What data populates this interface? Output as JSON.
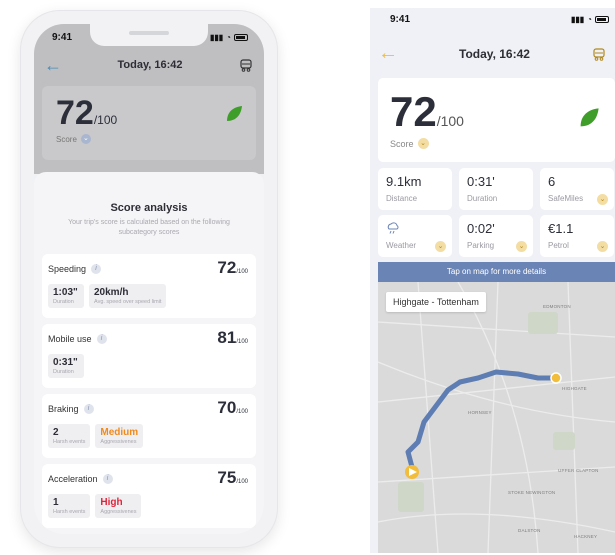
{
  "left_phone": {
    "status_time": "9:41",
    "nav_title": "Today, 16:42",
    "score": {
      "value": "72",
      "out_of": "/100",
      "label": "Score"
    },
    "sheet": {
      "title": "Score analysis",
      "subtitle": "Your trip's score is calculated based on the following subcategory scores"
    },
    "categories": [
      {
        "name": "Speeding",
        "score": "72",
        "out_of": "/100",
        "chips": [
          {
            "value": "1:03\"",
            "label": "Duration"
          },
          {
            "value": "20km/h",
            "label": "Avg. speed over speed limit"
          }
        ]
      },
      {
        "name": "Mobile use",
        "score": "81",
        "out_of": "/100",
        "chips": [
          {
            "value": "0:31\"",
            "label": "Duration"
          }
        ]
      },
      {
        "name": "Braking",
        "score": "70",
        "out_of": "/100",
        "chips": [
          {
            "value": "2",
            "label": "Harsh events"
          },
          {
            "value": "Medium",
            "label": "Aggressivenes"
          }
        ]
      },
      {
        "name": "Acceleration",
        "score": "75",
        "out_of": "/100",
        "chips": [
          {
            "value": "1",
            "label": "Harsh events"
          },
          {
            "value": "High",
            "label": "Aggressivenes"
          }
        ]
      }
    ]
  },
  "right_screen": {
    "status_time": "9:41",
    "nav_title": "Today, 16:42",
    "score": {
      "value": "72",
      "out_of": "/100",
      "label": "Score"
    },
    "tiles": [
      {
        "value": "9.1km",
        "label": "Distance"
      },
      {
        "value": "0:31'",
        "label": "Duration"
      },
      {
        "value": "6",
        "label": "SafeMiles"
      },
      {
        "value": "",
        "label": "Weather"
      },
      {
        "value": "0:02'",
        "label": "Parking"
      },
      {
        "value": "€1.1",
        "label": "Petrol"
      }
    ],
    "map_banner": "Tap on map for more details",
    "map_route_label": "Highgate - Tottenham",
    "map_places": [
      "EDMONTON",
      "HORNSEY",
      "STOKE NEWINGTON",
      "DALSTON",
      "HACKNEY",
      "UPPER CLAPTON",
      "HIGHGATE"
    ]
  },
  "colors": {
    "accent_blue": "#4a8db5",
    "accent_yellow": "#f2bd3a",
    "leaf_green": "#3f9e2a",
    "route_blue": "#5e7db3",
    "medium_orange": "#f08a1c",
    "high_red": "#e0243a"
  }
}
